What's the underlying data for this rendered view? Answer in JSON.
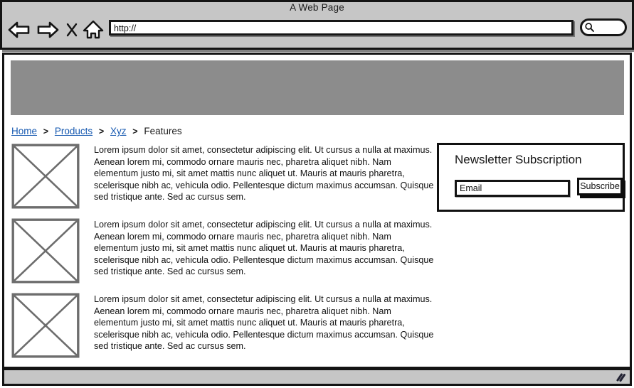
{
  "browser": {
    "title": "A Web Page",
    "toolbar": {
      "back_icon": "back-arrow-icon",
      "forward_icon": "forward-arrow-icon",
      "stop_icon": "stop-x-icon",
      "home_icon": "home-icon",
      "search_icon": "search-magnifier-icon"
    },
    "url_bar": {
      "value": "http://",
      "placeholder": "http://"
    },
    "search": {
      "value": "",
      "placeholder": ""
    },
    "status_bar": {
      "text": "",
      "resize_grip_icon": "resize-grip-icon"
    }
  },
  "page": {
    "hero": {
      "label": "",
      "color": "#8c8c8c"
    },
    "breadcrumb": {
      "separator": ">",
      "items": [
        {
          "label": "Home",
          "is_link": true
        },
        {
          "label": "Products",
          "is_link": true
        },
        {
          "label": "Xyz",
          "is_link": true
        },
        {
          "label": "Features",
          "is_link": false
        }
      ]
    },
    "content_rows": [
      {
        "image_alt": "image-placeholder",
        "paragraph": "Lorem ipsum dolor sit amet, consectetur adipiscing elit. Ut cursus a nulla at maximus. Aenean lorem mi, commodo ornare mauris nec, pharetra aliquet nibh. Nam elementum justo mi, sit amet mattis nunc aliquet ut. Mauris at mauris pharetra, scelerisque nibh ac, vehicula odio. Pellentesque dictum maximus accumsan. Quisque sed tristique ante. Sed ac cursus sem."
      },
      {
        "image_alt": "image-placeholder",
        "paragraph": "Lorem ipsum dolor sit amet, consectetur adipiscing elit. Ut cursus a nulla at maximus. Aenean lorem mi, commodo ornare mauris nec, pharetra aliquet nibh. Nam elementum justo mi, sit amet mattis nunc aliquet ut. Mauris at mauris pharetra, scelerisque nibh ac, vehicula odio. Pellentesque dictum maximus accumsan. Quisque sed tristique ante. Sed ac cursus sem."
      },
      {
        "image_alt": "image-placeholder",
        "paragraph": "Lorem ipsum dolor sit amet, consectetur adipiscing elit. Ut cursus a nulla at maximus. Aenean lorem mi, commodo ornare mauris nec, pharetra aliquet nibh. Nam elementum justo mi, sit amet mattis nunc aliquet ut. Mauris at mauris pharetra, scelerisque nibh ac, vehicula odio. Pellentesque dictum maximus accumsan. Quisque sed tristique ante. Sed ac cursus sem."
      }
    ],
    "newsletter": {
      "title": "Newsletter Subscription",
      "email_value": "Email",
      "email_placeholder": "Email",
      "subscribe_label": "Subscribe"
    }
  },
  "colors": {
    "chrome_gray": "#c6c6c6",
    "hero_gray": "#8c8c8c",
    "ink": "#111111",
    "link_blue": "#1558b0",
    "paper": "#ffffff"
  }
}
